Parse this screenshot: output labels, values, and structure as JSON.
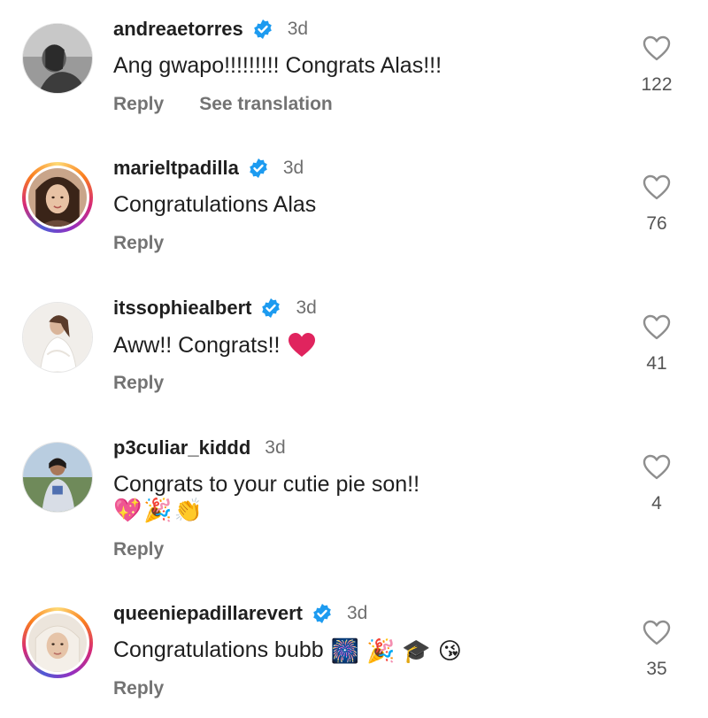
{
  "comments": [
    {
      "username": "andreaetorres",
      "verified": true,
      "time": "3d",
      "text": "Ang gwapo!!!!!!!!! Congrats Alas!!!",
      "reply_label": "Reply",
      "translate_label": "See translation",
      "likes": "122",
      "avatar": "avatar-bw-photo"
    },
    {
      "username": "marieltpadilla",
      "verified": true,
      "time": "3d",
      "text": "Congratulations Alas",
      "reply_label": "Reply",
      "likes": "76",
      "avatar": "avatar-story-ring"
    },
    {
      "username": "itssophiealbert",
      "verified": true,
      "time": "3d",
      "text": "Aww!! Congrats!!",
      "reply_label": "Reply",
      "likes": "41",
      "avatar": "avatar-white-dress"
    },
    {
      "username": "p3culiar_kiddd",
      "verified": false,
      "time": "3d",
      "text": "Congrats to your cutie pie son!!",
      "emojis": [
        "💖",
        "🎉",
        "👏"
      ],
      "reply_label": "Reply",
      "likes": "4",
      "avatar": "avatar-outdoor"
    },
    {
      "username": "queeniepadillarevert",
      "verified": true,
      "time": "3d",
      "text": "Congratulations bubb",
      "emojis": [
        "🎆",
        "🎉",
        "🎓",
        "😘"
      ],
      "reply_label": "Reply",
      "likes": "35",
      "avatar": "avatar-story-ring-hijab"
    }
  ],
  "colors": {
    "verified_blue": "#1d9bf0",
    "heart_red": "#e0245e",
    "muted": "#737373"
  }
}
